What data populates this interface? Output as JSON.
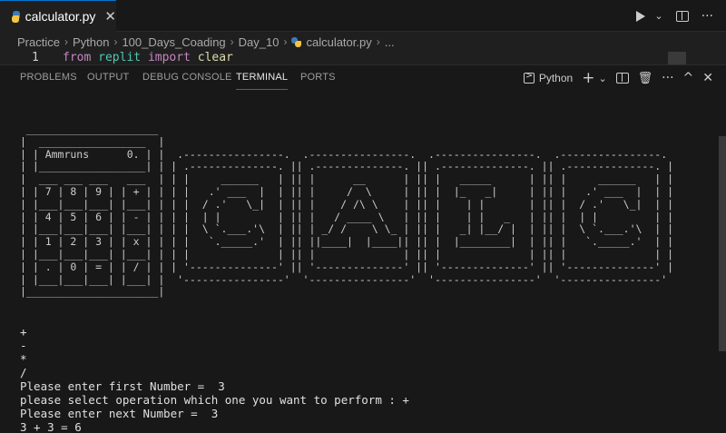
{
  "editor": {
    "tab": {
      "label": "calculator.py",
      "close": "✕"
    },
    "breadcrumb": [
      "Practice",
      "Python",
      "100_Days_Coading",
      "Day_10",
      "calculator.py",
      "..."
    ],
    "code_line": {
      "number": "1",
      "keyword_from": "from",
      "module": "replit",
      "keyword_import": "import",
      "name": "clear"
    }
  },
  "toolbar_icons": {
    "run": "play-icon",
    "more": "chevron-down-icon",
    "split": "split-editor-icon",
    "ellipsis": "···"
  },
  "panel": {
    "tabs": [
      "PROBLEMS",
      "OUTPUT",
      "DEBUG CONSOLE",
      "TERMINAL",
      "PORTS"
    ],
    "active_tab": "TERMINAL",
    "shell_label": "Python",
    "actions": {
      "add": "+",
      "dropdown": "⌄",
      "ellipsis": "···",
      "maximize": "^",
      "close": "✕"
    }
  },
  "terminal": {
    "ascii_art": " _____________________\n|  _________________  |\n| | Ammruns      0. | |  .----------------.  .----------------.  .----------------.  .----------------.\n| |_________________| | | .--------------. || .--------------. || .--------------. || .--------------. |\n|  ___ ___ ___   ___  | | |     ______   | || |      __      | || |   _____      | || |     ______   | |\n| | 7 | 8 | 9 | | + | | | |   .' ___  |  | || |     /  \\     | || |  |_   _|     | || |   .' ___  |  | |\n| |___|___|___| |___| | | |  / .'   \\_|  | || |    / /\\ \\    | || |    | |       | || |  / .'   \\_|  | |\n| | 4 | 5 | 6 | | - | | | |  | |         | || |   / ____ \\   | || |    | |   _   | || |  | |         | |\n| |___|___|___| |___| | | |  \\ `.___.'\\  | || | _/ /    \\ \\_ | || |   _| |__/ |  | || |  \\ `.___.'\\  | |\n| | 1 | 2 | 3 | | x | | | |   `._____.'  | || ||____|  |____|| || |  |________|  | || |   `._____.'  | |\n| |___|___|___| |___| | | |              | || |              | || |              | || |              | |\n| | . | 0 | = | | / | | | '--------------' || '--------------' || '--------------' || '--------------' |\n| |___|___|___| |___| |  '----------------'  '----------------'  '----------------'  '----------------'\n|_____________________|",
    "lines": [
      "+",
      "-",
      "*",
      "/",
      "Please enter first Number =  3",
      "please select operation which one you want to perform : +",
      "Please enter next Number =  3",
      "3 + 3 = 6"
    ]
  }
}
